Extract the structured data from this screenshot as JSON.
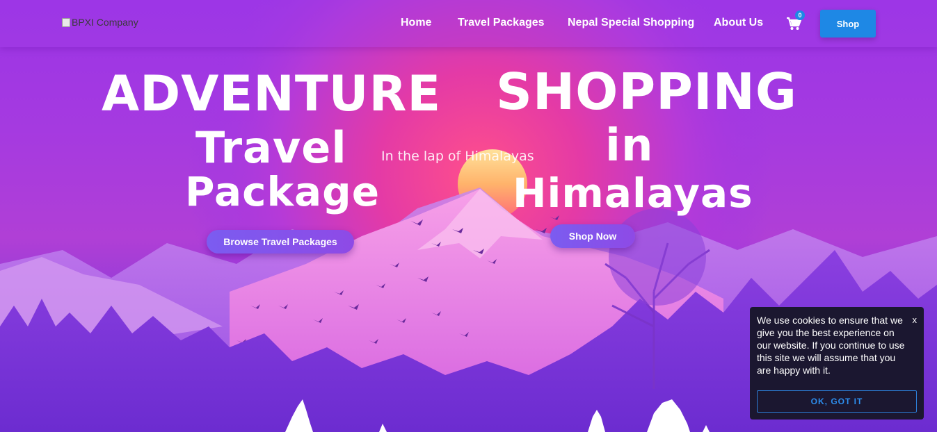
{
  "nav": {
    "logo_alt": "BPXI Company",
    "links": [
      "Home",
      "Travel Packages",
      "Nepal Special Shopping",
      "About Us"
    ],
    "cart_count": "0",
    "shop_label": "Shop"
  },
  "hero": {
    "left": {
      "line1": "ADVENTURE",
      "line2": "Travel",
      "line3": "Package",
      "cta": "Browse Travel Packages"
    },
    "tagline": "In the lap of Himalayas",
    "right": {
      "line1": "SHOPPING",
      "line2": "in",
      "line3": "Himalayas",
      "cta": "Shop Now"
    }
  },
  "cookie": {
    "message": "We use cookies to ensure that we give you the best experience on our website. If you continue to use this site we will assume that you are happy with it.",
    "close": "x",
    "accept": "OK, GOT IT"
  },
  "colors": {
    "accent_blue": "#1e88e5",
    "hero_purple": "#9b34e6",
    "hero_pink": "#e8429a"
  }
}
